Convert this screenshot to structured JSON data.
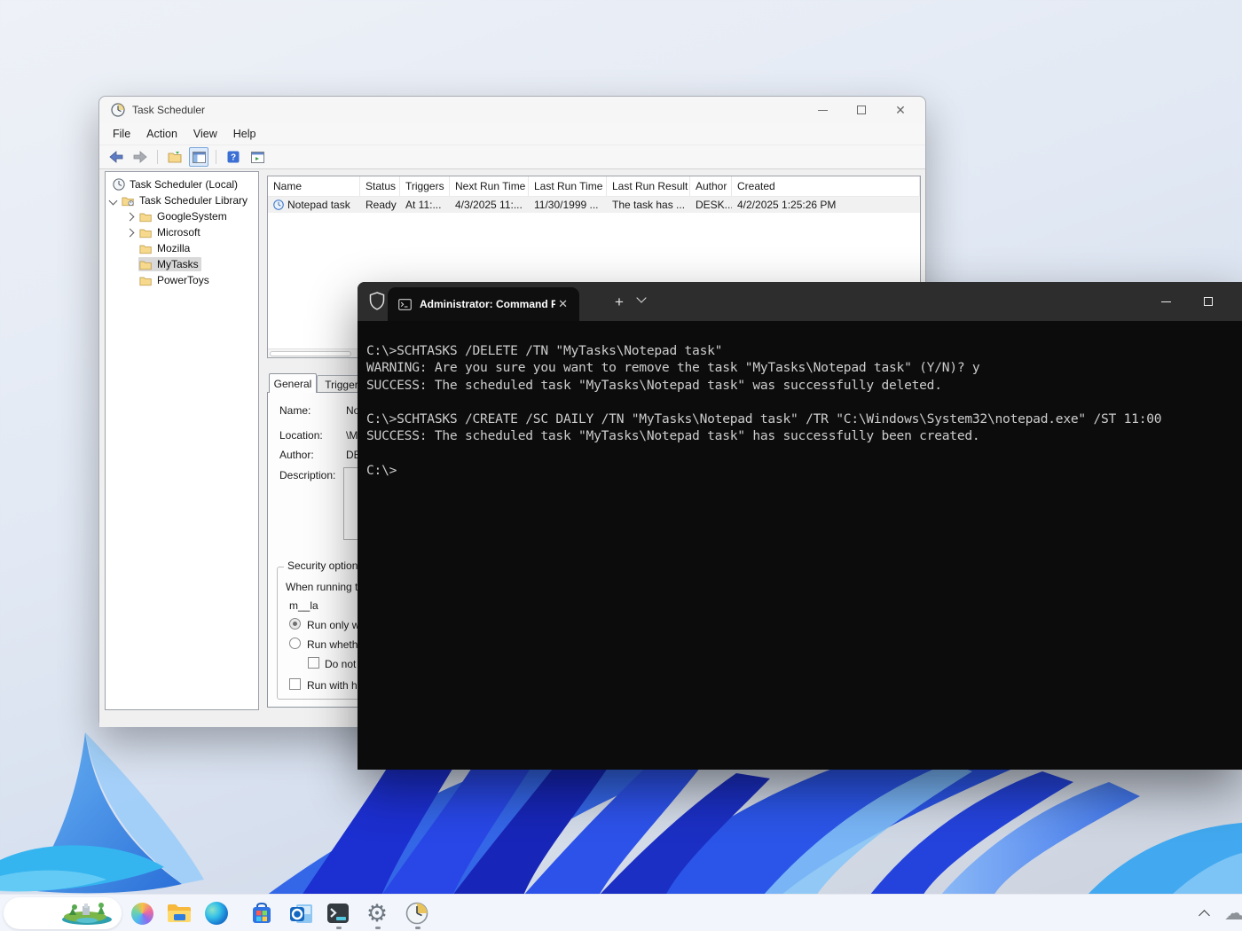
{
  "task_scheduler": {
    "title": "Task Scheduler",
    "menu": {
      "file": "File",
      "action": "Action",
      "view": "View",
      "help": "Help"
    },
    "tree": {
      "root_label": "Task Scheduler (Local)",
      "library_label": "Task Scheduler Library",
      "folders": [
        {
          "label": "GoogleSystem"
        },
        {
          "label": "Microsoft"
        },
        {
          "label": "Mozilla"
        },
        {
          "label": "MyTasks"
        },
        {
          "label": "PowerToys"
        }
      ]
    },
    "task_list": {
      "columns": [
        "Name",
        "Status",
        "Triggers",
        "Next Run Time",
        "Last Run Time",
        "Last Run Result",
        "Author",
        "Created"
      ],
      "rows": [
        [
          "Notepad task",
          "Ready",
          "At 11:...",
          "4/3/2025 11:...",
          "11/30/1999 ...",
          "The task has ...",
          "DESK...",
          "4/2/2025 1:25:26 PM"
        ]
      ]
    },
    "properties": {
      "tabs": {
        "general": "General",
        "triggers": "Triggers"
      },
      "fields": {
        "name_label": "Name:",
        "name_value": "No",
        "location_label": "Location:",
        "location_value": "\\M",
        "author_label": "Author:",
        "author_value": "DE",
        "description_label": "Description:"
      },
      "security": {
        "group_label": "Security options",
        "when_running": "When running t",
        "account": "m__la",
        "radio_run_only": "Run only wh",
        "radio_run_whether": "Run whethe",
        "check_do_not_store": "Do not s",
        "check_run_highest": "Run with hig"
      }
    }
  },
  "terminal": {
    "tab_title": "Administrator: Command Pro",
    "tab_close": "✕",
    "new_tab": "+",
    "lines": [
      "C:\\>SCHTASKS /DELETE /TN \"MyTasks\\Notepad task\"",
      "WARNING: Are you sure you want to remove the task \"MyTasks\\Notepad task\" (Y/N)? y",
      "SUCCESS: The scheduled task \"MyTasks\\Notepad task\" was successfully deleted.",
      "",
      "C:\\>SCHTASKS /CREATE /SC DAILY /TN \"MyTasks\\Notepad task\" /TR \"C:\\Windows\\System32\\notepad.exe\" /ST 11:00",
      "SUCCESS: The scheduled task \"MyTasks\\Notepad task\" has successfully been created.",
      "",
      "C:\\>"
    ]
  },
  "taskbar": {
    "icons": [
      "widgets",
      "copilot",
      "file-explorer",
      "edge",
      "store",
      "outlook",
      "terminal",
      "settings",
      "task-scheduler-clock"
    ],
    "running": [
      "terminal",
      "settings",
      "task-scheduler-clock"
    ]
  },
  "colors": {
    "terminal_bg": "#0c0c0c",
    "terminal_titlebar": "#2d2d2d",
    "terminal_text": "#cccccc",
    "taskbar_bg": "#f2f6fc",
    "bloom_dark_blue": "#1c2fd0",
    "bloom_light_blue": "#4fa1ee",
    "bloom_cyan": "#35b5ef"
  }
}
